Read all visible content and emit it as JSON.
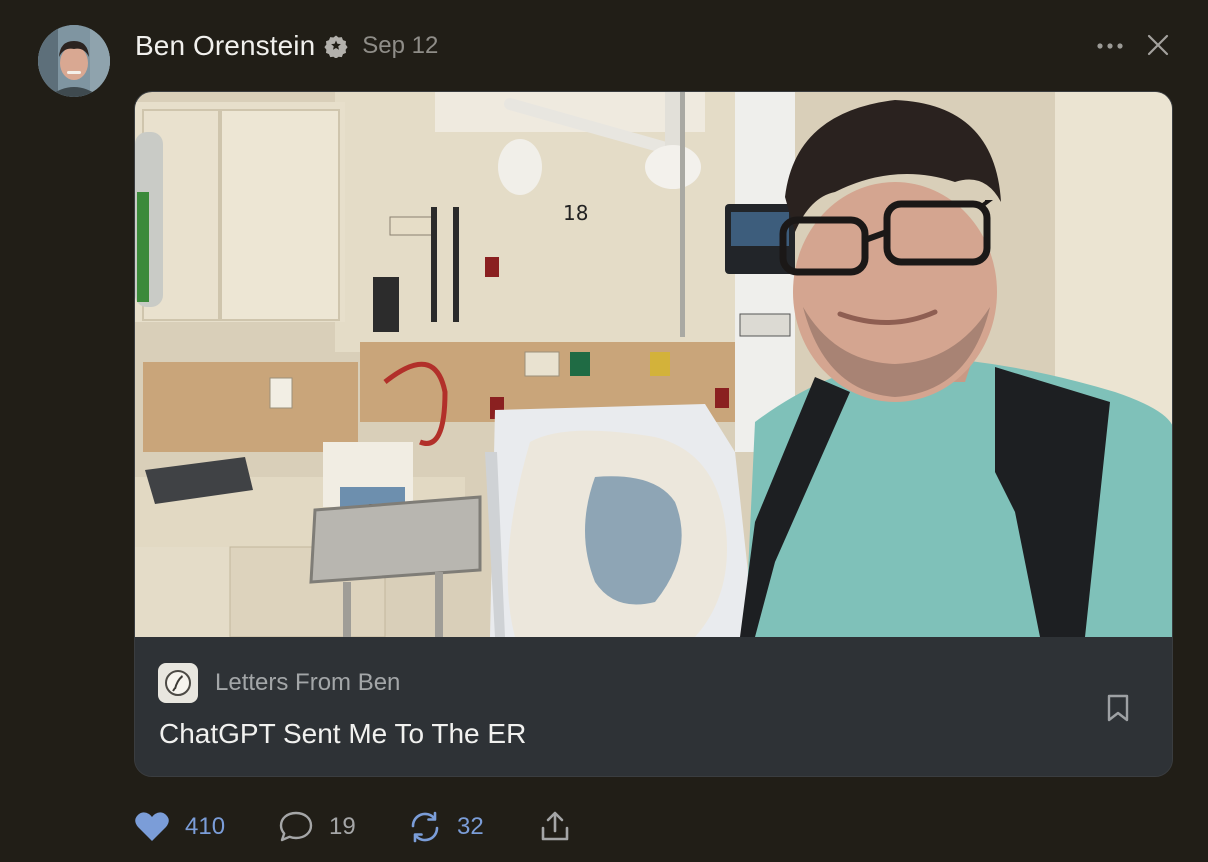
{
  "post": {
    "author": "Ben Orenstein",
    "date": "Sep 12"
  },
  "card": {
    "publication": "Letters From Ben",
    "title": "ChatGPT Sent Me To The ER"
  },
  "actions": {
    "likes": "410",
    "comments": "19",
    "restacks": "32"
  },
  "icons": {
    "verified": "verified-badge-icon",
    "more": "more-options-icon",
    "close": "close-icon",
    "bookmark": "bookmark-icon",
    "like": "heart-icon",
    "comment": "comment-icon",
    "restack": "restack-icon",
    "share": "share-icon"
  },
  "colors": {
    "background": "#211e17",
    "accent": "#7b9dd8",
    "card_footer": "#2e3236"
  }
}
